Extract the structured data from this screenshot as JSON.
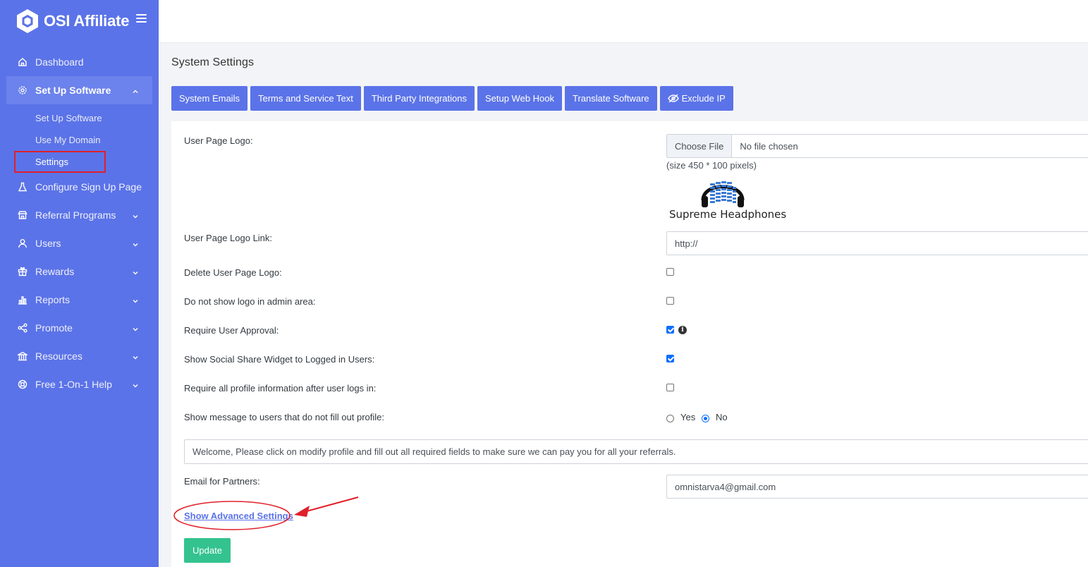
{
  "brand": {
    "name": "OSI Affiliate"
  },
  "sidebar": {
    "items": [
      {
        "label": "Dashboard",
        "icon": "home-icon"
      },
      {
        "label": "Set Up Software",
        "icon": "gear-icon",
        "expanded": true,
        "children": [
          {
            "label": "Set Up Software"
          },
          {
            "label": "Use My Domain"
          },
          {
            "label": "Settings",
            "current": true
          }
        ]
      },
      {
        "label": "Configure Sign Up Page",
        "icon": "flask-icon"
      },
      {
        "label": "Referral Programs",
        "icon": "store-icon"
      },
      {
        "label": "Users",
        "icon": "user-icon"
      },
      {
        "label": "Rewards",
        "icon": "gift-icon"
      },
      {
        "label": "Reports",
        "icon": "bar-chart-icon"
      },
      {
        "label": "Promote",
        "icon": "share-icon"
      },
      {
        "label": "Resources",
        "icon": "bank-icon"
      },
      {
        "label": "Free 1-On-1 Help",
        "icon": "lifebuoy-icon"
      }
    ]
  },
  "page": {
    "title": "System Settings"
  },
  "tabs": [
    {
      "label": "System Emails"
    },
    {
      "label": "Terms and Service Text"
    },
    {
      "label": "Third Party Integrations"
    },
    {
      "label": "Setup Web Hook"
    },
    {
      "label": "Translate Software"
    },
    {
      "label": "Exclude IP",
      "icon": "eye-slash-icon"
    }
  ],
  "form": {
    "user_page_logo": {
      "label": "User Page Logo:",
      "button": "Choose File",
      "status": "No file chosen",
      "hint": "(size 450 * 100 pixels)",
      "preview_caption": "Supreme Headphones"
    },
    "logo_link": {
      "label": "User Page Logo Link:",
      "value": "http://"
    },
    "delete_logo": {
      "label": "Delete User Page Logo:",
      "checked": false
    },
    "hide_admin_logo": {
      "label": "Do not show logo in admin area:",
      "checked": false
    },
    "require_approval": {
      "label": "Require User Approval:",
      "checked": true
    },
    "social_share": {
      "label": "Show Social Share Widget to Logged in Users:",
      "checked": true
    },
    "require_profile": {
      "label": "Require all profile information after user logs in:",
      "checked": false
    },
    "profile_message": {
      "label": "Show message to users that do not fill out profile:",
      "options": [
        "Yes",
        "No"
      ],
      "selected": "No",
      "message": "Welcome, Please click on modify profile and fill out all required fields to make sure we can pay you for all your referrals."
    },
    "partner_email": {
      "label": "Email for Partners:",
      "value": "omnistarva4@gmail.com"
    },
    "advanced_link": "Show Advanced Settings",
    "update_button": "Update"
  },
  "colors": {
    "primary": "#5b73e8",
    "success": "#34c38f",
    "annotation": "#e0202a"
  }
}
